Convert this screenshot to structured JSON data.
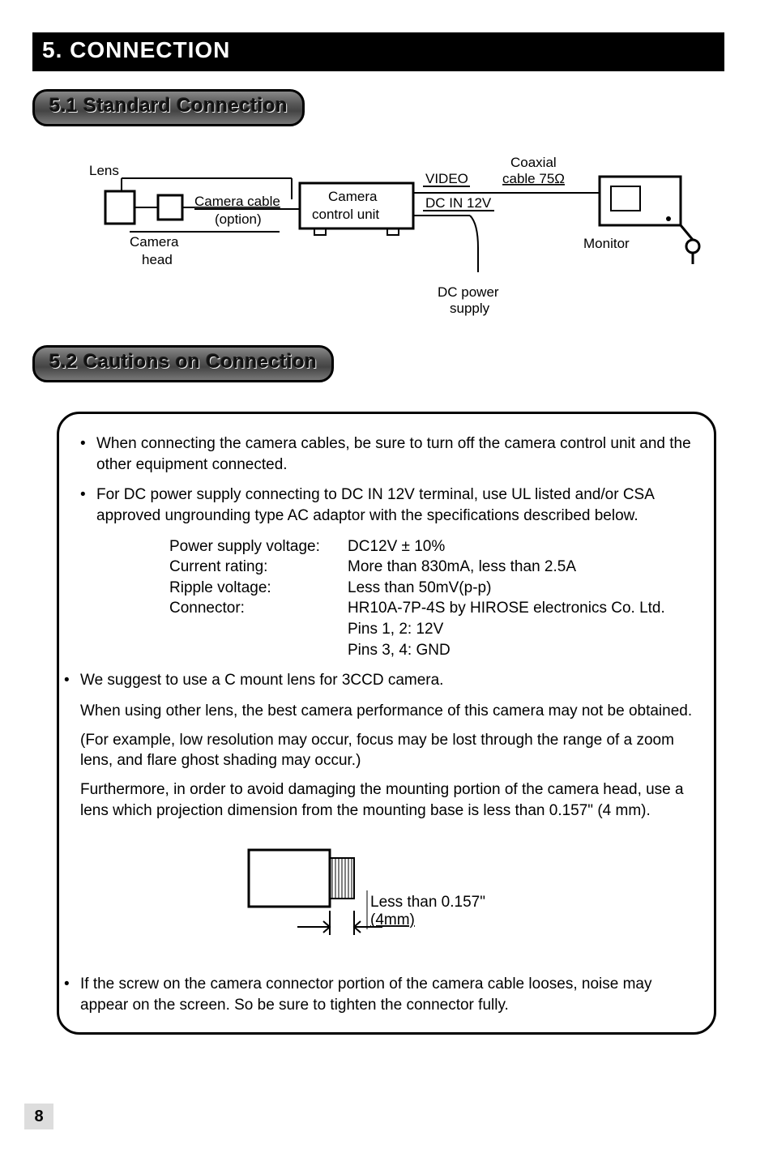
{
  "section": {
    "title": "5. CONNECTION"
  },
  "sub1": {
    "title": "5.1 Standard Connection"
  },
  "diagram": {
    "lens": "Lens",
    "camera_cable": "Camera cable",
    "option": "(option)",
    "camera_head": "Camera",
    "camera_head2": "head",
    "ccu1": "Camera",
    "ccu2": "control unit",
    "video": "VIDEO",
    "dcin": "DC IN 12V",
    "coax1": "Coaxial",
    "coax2": "cable 75Ω",
    "monitor": "Monitor",
    "dcpower1": "DC power",
    "dcpower2": "supply"
  },
  "sub2": {
    "title": "5.2 Cautions on Connection"
  },
  "cautions": {
    "b1": "When connecting the camera cables, be sure to turn off the camera control unit and the other equipment connected.",
    "b2": "For DC power supply connecting to DC IN 12V terminal, use UL listed and/or CSA approved ungrounding type AC adaptor with the specifications described below.",
    "specs": {
      "psv_label": "Power supply voltage:",
      "psv_val": "DC12V ± 10%",
      "cur_label": "Current rating:",
      "cur_val": "More than 830mA, less than 2.5A",
      "rip_label": "Ripple voltage:",
      "rip_val": "Less than 50mV(p-p)",
      "con_label": "Connector:",
      "con_val": "HR10A-7P-4S by HIROSE electronics Co. Ltd.",
      "pins12": "Pins 1, 2: 12V",
      "pins34": "Pins 3, 4: GND"
    },
    "b3": "We suggest to use a C mount lens for 3CCD camera.",
    "p3a": "When using other lens, the best camera performance of this camera may not be obtained.",
    "p3b": "(For example, low resolution may occur, focus may be lost through the range of a zoom lens, and flare ghost shading may occur.)",
    "p3c": "Furthermore, in order to avoid damaging the mounting portion of the camera head, use a lens which projection dimension from the mounting base is less than 0.157\" (4 mm).",
    "lensdiag1": "Less than 0.157\"",
    "lensdiag2": "(4mm)",
    "b4": "If the screw on the camera connector portion of the camera cable looses, noise may appear on the screen. So be sure to tighten the connector fully."
  },
  "pagenum": "8"
}
